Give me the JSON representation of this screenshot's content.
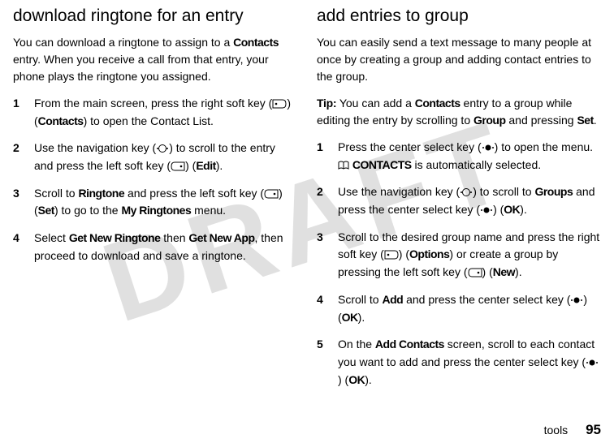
{
  "watermark": "DRAFT",
  "left": {
    "heading": "download ringtone for an entry",
    "intro_a": "You can download a ringtone to assign to a ",
    "intro_bold1": "Contacts",
    "intro_b": " entry. When you receive a call from that entry, your phone plays the ringtone you assigned.",
    "steps": [
      {
        "n": "1",
        "segments": [
          {
            "t": "From the main screen, press the right soft key ("
          },
          {
            "icon": "right-soft"
          },
          {
            "t": ") ("
          },
          {
            "b": "Contacts"
          },
          {
            "t": ") to open the Contact List."
          }
        ]
      },
      {
        "n": "2",
        "segments": [
          {
            "t": "Use the navigation key ("
          },
          {
            "icon": "nav"
          },
          {
            "t": ") to scroll to the entry and press the left soft key ("
          },
          {
            "icon": "left-soft"
          },
          {
            "t": ") ("
          },
          {
            "b": "Edit"
          },
          {
            "t": ")."
          }
        ]
      },
      {
        "n": "3",
        "segments": [
          {
            "t": "Scroll to "
          },
          {
            "b": "Ringtone"
          },
          {
            "t": " and press the left soft key ("
          },
          {
            "icon": "left-soft"
          },
          {
            "t": ") ("
          },
          {
            "b": "Set"
          },
          {
            "t": ") to go to the "
          },
          {
            "b": "My Ringtones"
          },
          {
            "t": " menu."
          }
        ]
      },
      {
        "n": "4",
        "segments": [
          {
            "t": "Select "
          },
          {
            "b": "Get New Ringtone"
          },
          {
            "t": " then "
          },
          {
            "b": "Get New App"
          },
          {
            "t": ", then proceed to download and save a ringtone."
          }
        ]
      }
    ]
  },
  "right": {
    "heading": "add entries to group",
    "intro": "You can easily send a text message to many people at once by creating a group and adding contact entries to the group.",
    "tip_label": "Tip:",
    "tip_segments": [
      {
        "t": " You can add a "
      },
      {
        "b": "Contacts"
      },
      {
        "t": " entry to a group while editing the entry by scrolling to "
      },
      {
        "b": "Group"
      },
      {
        "t": " and pressing "
      },
      {
        "b": "Set"
      },
      {
        "t": "."
      }
    ],
    "steps": [
      {
        "n": "1",
        "segments": [
          {
            "t": "Press the center select key ("
          },
          {
            "icon": "center"
          },
          {
            "t": ") to open the menu. "
          },
          {
            "icon": "book"
          },
          {
            "t": " "
          },
          {
            "b": "CONTACTS"
          },
          {
            "t": " is automatically selected."
          }
        ]
      },
      {
        "n": "2",
        "segments": [
          {
            "t": "Use the navigation key ("
          },
          {
            "icon": "nav"
          },
          {
            "t": ") to scroll to "
          },
          {
            "b": "Groups"
          },
          {
            "t": " and press the center select key ("
          },
          {
            "icon": "center"
          },
          {
            "t": ") ("
          },
          {
            "b": "OK"
          },
          {
            "t": ")."
          }
        ]
      },
      {
        "n": "3",
        "segments": [
          {
            "t": "Scroll to the desired group name and press the right soft key ("
          },
          {
            "icon": "right-soft"
          },
          {
            "t": ") ("
          },
          {
            "b": "Options"
          },
          {
            "t": ") or create a group by pressing the left soft key ("
          },
          {
            "icon": "left-soft"
          },
          {
            "t": ") ("
          },
          {
            "b": "New"
          },
          {
            "t": ")."
          }
        ]
      },
      {
        "n": "4",
        "segments": [
          {
            "t": "Scroll to "
          },
          {
            "b": "Add"
          },
          {
            "t": " and press the center select key ("
          },
          {
            "icon": "center"
          },
          {
            "t": ") ("
          },
          {
            "b": "OK"
          },
          {
            "t": ")."
          }
        ]
      },
      {
        "n": "5",
        "segments": [
          {
            "t": "On the "
          },
          {
            "b": "Add Contacts"
          },
          {
            "t": " screen, scroll to each contact you want to add and press the center select key ("
          },
          {
            "icon": "center"
          },
          {
            "t": ") ("
          },
          {
            "b": "OK"
          },
          {
            "t": ")."
          }
        ]
      }
    ]
  },
  "footer": {
    "section": "tools",
    "page": "95"
  },
  "icons": {
    "right-soft": "right-soft-key-icon",
    "left-soft": "left-soft-key-icon",
    "nav": "navigation-key-icon",
    "center": "center-select-key-icon",
    "book": "contacts-book-icon"
  }
}
